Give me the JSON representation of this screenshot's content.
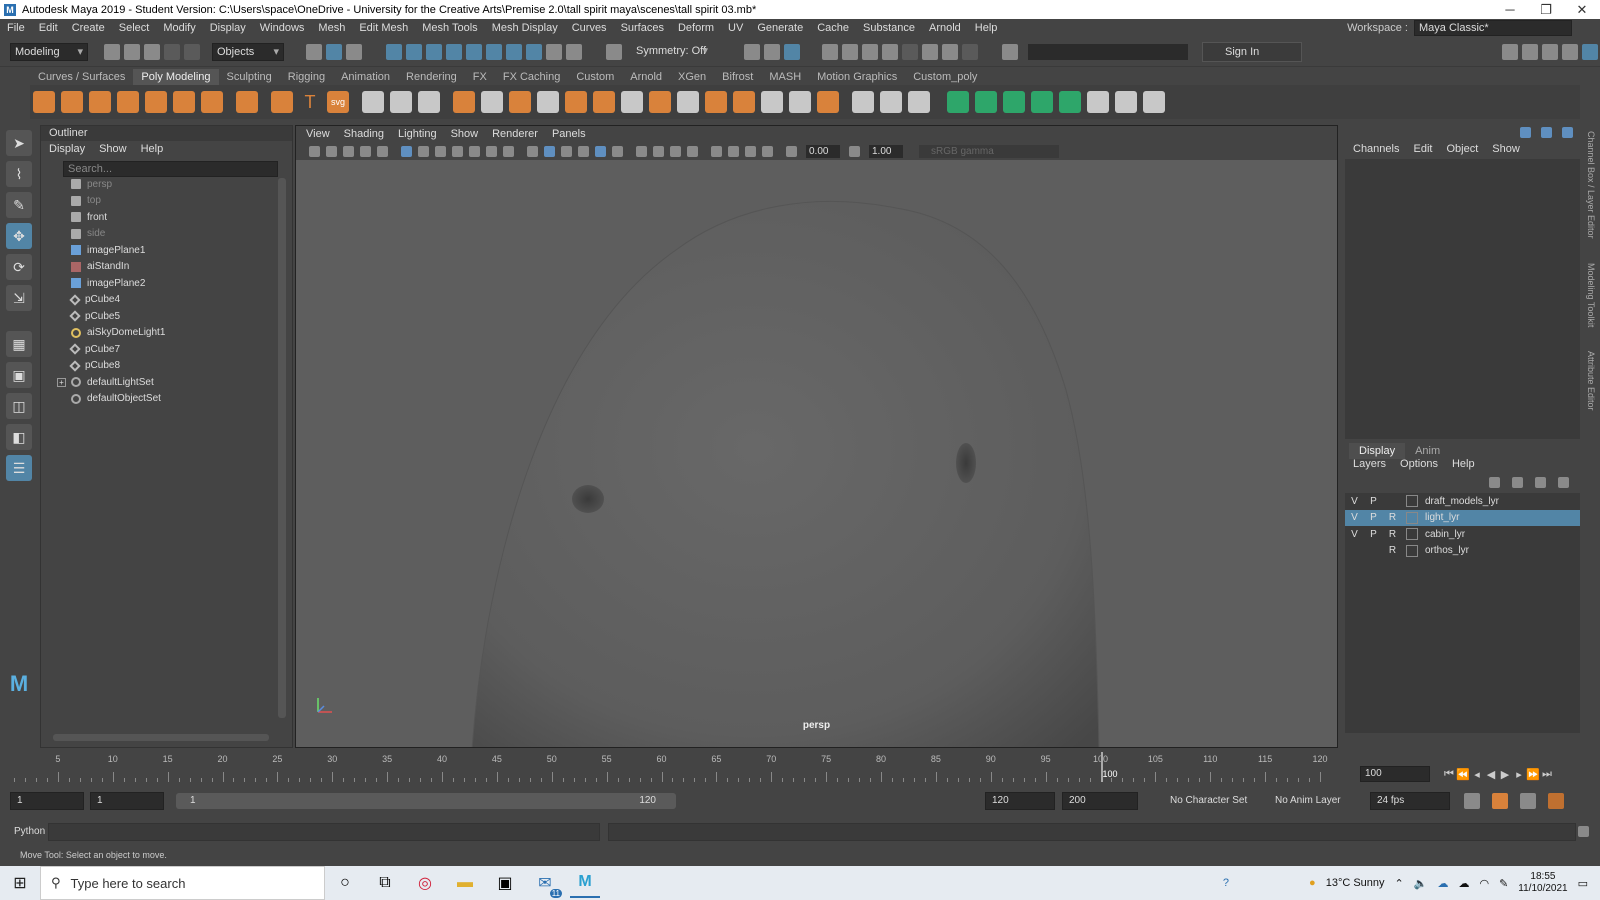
{
  "window": {
    "title": "Autodesk Maya 2019 - Student Version: C:\\Users\\space\\OneDrive - University for the Creative Arts\\Premise 2.0\\tall spirit maya\\scenes\\tall spirit 03.mb*",
    "app_icon_letter": "M",
    "min": "─",
    "max": "❐",
    "close": "✕"
  },
  "menubar": {
    "items": [
      "File",
      "Edit",
      "Create",
      "Select",
      "Modify",
      "Display",
      "Windows",
      "Mesh",
      "Edit Mesh",
      "Mesh Tools",
      "Mesh Display",
      "Curves",
      "Surfaces",
      "Deform",
      "UV",
      "Generate",
      "Cache",
      "Substance",
      "Arnold",
      "Help"
    ],
    "workspace_label": "Workspace :",
    "workspace_value": "Maya Classic*"
  },
  "statusline": {
    "menuset": "Modeling",
    "selection_mask": "Objects",
    "symmetry": "Symmetry: Off",
    "sign_in": "Sign In"
  },
  "shelf": {
    "tabs": [
      "Curves / Surfaces",
      "Poly Modeling",
      "Sculpting",
      "Rigging",
      "Animation",
      "Rendering",
      "FX",
      "FX Caching",
      "Custom",
      "Arnold",
      "XGen",
      "Bifrost",
      "MASH",
      "Motion Graphics",
      "Custom_poly"
    ],
    "active_tab": "Poly Modeling",
    "text_icon": "T",
    "svg_icon": "svg"
  },
  "outliner": {
    "title": "Outliner",
    "menu": [
      "Display",
      "Show",
      "Help"
    ],
    "search_placeholder": "Search...",
    "items": [
      {
        "name": "persp",
        "icon": "camera-icon",
        "dim": true
      },
      {
        "name": "top",
        "icon": "camera-icon",
        "dim": true
      },
      {
        "name": "front",
        "icon": "camera-icon",
        "dim": false
      },
      {
        "name": "side",
        "icon": "camera-icon",
        "dim": true
      },
      {
        "name": "imagePlane1",
        "icon": "image-plane-icon",
        "dim": false
      },
      {
        "name": "aiStandIn",
        "icon": "standin-icon",
        "dim": false
      },
      {
        "name": "imagePlane2",
        "icon": "image-plane-icon",
        "dim": false
      },
      {
        "name": "pCube4",
        "icon": "mesh-icon",
        "dim": false
      },
      {
        "name": "pCube5",
        "icon": "mesh-icon",
        "dim": false
      },
      {
        "name": "aiSkyDomeLight1",
        "icon": "light-icon",
        "dim": false
      },
      {
        "name": "pCube7",
        "icon": "mesh-icon",
        "dim": false
      },
      {
        "name": "pCube8",
        "icon": "mesh-icon",
        "dim": false
      },
      {
        "name": "defaultLightSet",
        "icon": "set-icon",
        "dim": false,
        "expandable": true
      },
      {
        "name": "defaultObjectSet",
        "icon": "set-icon",
        "dim": false
      }
    ]
  },
  "viewport": {
    "menu": [
      "View",
      "Shading",
      "Lighting",
      "Show",
      "Renderer",
      "Panels"
    ],
    "exposure": "0.00",
    "gamma": "1.00",
    "color_space": "sRGB gamma",
    "camera_label": "persp"
  },
  "channelbox": {
    "menu": [
      "Channels",
      "Edit",
      "Object",
      "Show"
    ],
    "layer_tabs": [
      "Display",
      "Anim"
    ],
    "active_layer_tab": "Display",
    "layer_menu": [
      "Layers",
      "Options",
      "Help"
    ],
    "layers": [
      {
        "v": "V",
        "p": "P",
        "r": "",
        "name": "draft_models_lyr",
        "selected": false
      },
      {
        "v": "V",
        "p": "P",
        "r": "R",
        "name": "light_lyr",
        "selected": true
      },
      {
        "v": "V",
        "p": "P",
        "r": "R",
        "name": "cabin_lyr",
        "selected": false
      },
      {
        "v": "",
        "p": "",
        "r": "R",
        "name": "orthos_lyr",
        "selected": false
      }
    ],
    "side_tabs": [
      "Channel Box / Layer Editor",
      "Modeling Toolkit",
      "Attribute Editor"
    ]
  },
  "timeline": {
    "ticks": [
      5,
      10,
      15,
      20,
      25,
      30,
      35,
      40,
      45,
      50,
      55,
      60,
      65,
      70,
      75,
      80,
      85,
      90,
      95,
      100,
      105,
      110,
      115,
      120
    ],
    "current_frame": "100",
    "current_frame_field": "100"
  },
  "range": {
    "start_frame": "1",
    "playback_start": "1",
    "slider_start": "1",
    "slider_end": "120",
    "playback_end": "120",
    "end_frame": "200",
    "character_set": "No Character Set",
    "anim_layer": "No Anim Layer",
    "fps": "24 fps"
  },
  "cmdline": {
    "label": "Python"
  },
  "helpline": {
    "text": "Move Tool: Select an object to move."
  },
  "taskbar": {
    "search_placeholder": "Type here to search",
    "weather": "13°C  Sunny",
    "time": "18:55",
    "date": "11/10/2021",
    "mail_badge": "11"
  }
}
